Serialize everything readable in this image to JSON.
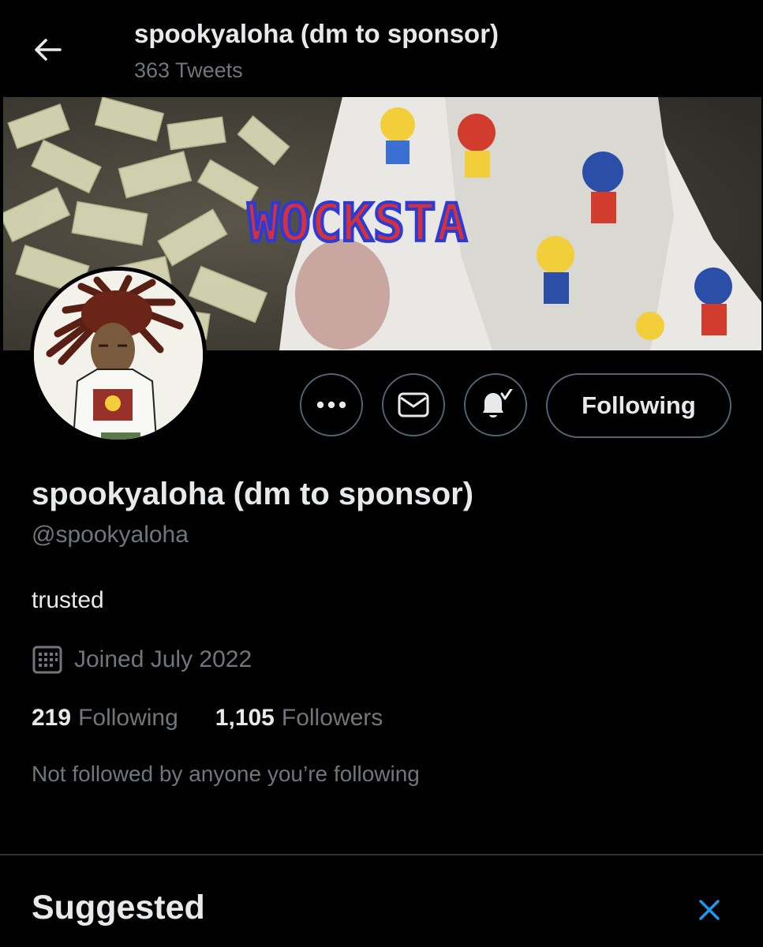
{
  "header": {
    "title": "spookyaloha (dm to sponsor)",
    "tweet_count": "363 Tweets",
    "back_icon": "arrow-left-icon"
  },
  "banner": {
    "overlay_text": "WOCKSTA"
  },
  "actions": {
    "more_icon": "more-dots-icon",
    "message_icon": "envelope-icon",
    "notify_icon": "bell-check-icon",
    "following_label": "Following"
  },
  "profile": {
    "name": "spookyaloha (dm to sponsor)",
    "handle": "@spookyaloha",
    "bio": "trusted",
    "joined": "Joined July 2022",
    "following_count": "219",
    "following_label": "Following",
    "followers_count": "1,105",
    "followers_label": "Followers",
    "mutuals_note": "Not followed by anyone you’re following"
  },
  "suggested": {
    "title": "Suggested",
    "close_icon": "close-icon"
  },
  "colors": {
    "background": "#000000",
    "text_primary": "#e7e9ea",
    "text_secondary": "#71767b",
    "border": "#536471",
    "accent": "#1d9bf0"
  }
}
